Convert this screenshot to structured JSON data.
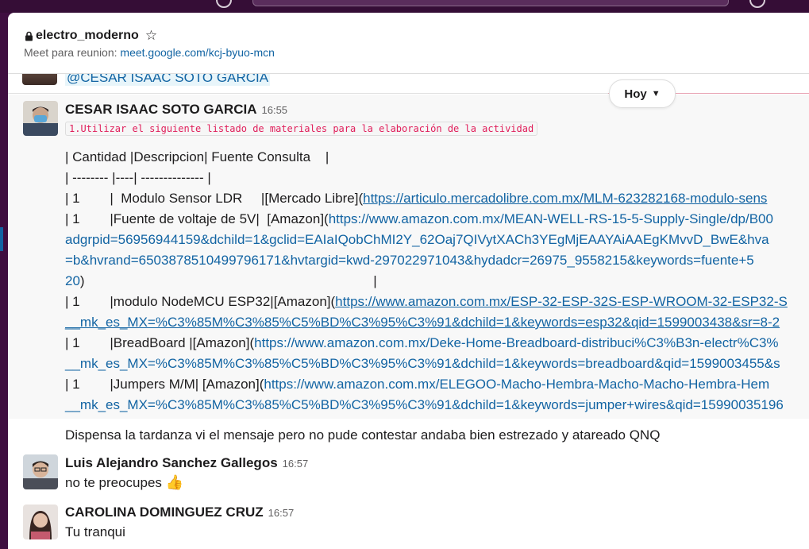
{
  "channel": {
    "name": "electro_moderno",
    "topic_prefix": "Meet para reunion: ",
    "topic_link": "meet.google.com/kcj-byuo-mcn"
  },
  "mention": "@CESAR ISAAC SOTO GARCIA",
  "date_divider": "Hoy",
  "messages": [
    {
      "sender": "CESAR ISAAC SOTO GARCIA",
      "time": "16:55",
      "code": "1.Utilizar el siguiente listado de materiales para la elaboración de la actividad",
      "lines": [
        {
          "text": "| Cantidad |Descripcion| Fuente Consulta    |"
        },
        {
          "text": "| -------- |----| -------------- |"
        },
        {
          "text": "| 1        |  Modulo Sensor LDR     |[Mercado Libre](",
          "link": "https://articulo.mercadolibre.com.mx/MLM-623282168-modulo-sens"
        },
        {
          "text": "| 1        |Fuente de voltaje de 5V|  [Amazon](",
          "link": "https://www.amazon.com.mx/MEAN-WELL-RS-15-5-Supply-Single/dp/B00"
        },
        {
          "text": "",
          "link": "adgrpid=56956944159&dchild=1&gclid=EAIaIQobChMI2Y_62Oaj7QIVytXACh3YEgMjEAAYAiAAEgKMvvD_BwE&hva"
        },
        {
          "text": "",
          "link": "=b&hvrand=6503878510499796171&hvtargid=kwd-297022971043&hydadcr=26975_9558215&keywords=fuente+5"
        },
        {
          "text": "",
          "link": "20",
          "after": ")                                                                             |"
        },
        {
          "text": "| 1        |modulo NodeMCU ESP32|[Amazon](",
          "link": "https://www.amazon.com.mx/ESP-32-ESP-32S-ESP-WROOM-32-ESP32-S"
        },
        {
          "text": "",
          "link": "__mk_es_MX=%C3%85M%C3%85%C5%BD%C3%95%C3%91&dchild=1&keywords=esp32&qid=1599003438&sr=8-2"
        },
        {
          "text": "| 1        |BreadBoard |[Amazon](",
          "link": "https://www.amazon.com.mx/Deke-Home-Breadboard-distribuci%C3%B3n-electr%C3%"
        },
        {
          "text": "",
          "link": "__mk_es_MX=%C3%85M%C3%85%C5%BD%C3%95%C3%91&dchild=1&keywords=breadboard&qid=1599003455&s"
        },
        {
          "text": "| 1        |Jumpers M/M| [Amazon](",
          "link": "https://www.amazon.com.mx/ELEGOO-Macho-Hembra-Macho-Macho-Hembra-Hem"
        },
        {
          "text": "",
          "link": "__mk_es_MX=%C3%85M%C3%85%C5%BD%C3%95%C3%91&dchild=1&keywords=jumper+wires&qid=15990035196"
        }
      ],
      "followup": "Dispensa la tardanza vi el mensaje pero no pude contestar andaba bien estrezado y atareado QNQ"
    },
    {
      "sender": "Luis Alejandro Sanchez Gallegos",
      "time": "16:57",
      "text": "no te preocupes",
      "emoji": "👍"
    },
    {
      "sender": "CAROLINA DOMINGUEZ CRUZ",
      "time": "16:57",
      "text": "Tu tranqui"
    }
  ],
  "colors": {
    "sidebar": "#3f0e40",
    "link": "#1264a3",
    "code_text": "#e01e5a",
    "highlight": "#f8f8f8"
  },
  "icons": [
    "lock-icon",
    "star-icon",
    "chevron-down-icon",
    "thumbs-up-icon"
  ]
}
